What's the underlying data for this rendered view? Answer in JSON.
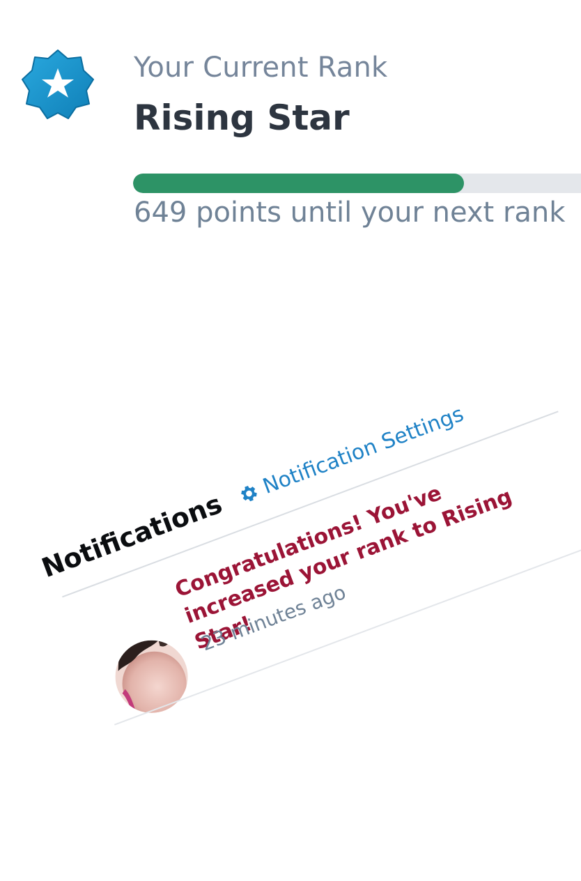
{
  "rank": {
    "subtitle": "Your Current Rank",
    "name": "Rising Star",
    "badge_icon": "star-badge-icon",
    "progress_fraction": 0.72,
    "progress_text": "649 points until your next rank"
  },
  "notifications": {
    "title": "Notifications",
    "settings_icon": "gear-icon",
    "settings_label": "Notification Settings",
    "items": [
      {
        "message": "Congratulations! You've increased your rank to Rising Star!",
        "time": "23 minutes ago"
      }
    ]
  },
  "colors": {
    "badge": "#1a8fc7",
    "progress_fill": "#2d9366",
    "progress_track": "#e4e7eb",
    "notification_message": "#9b1436",
    "settings_link": "#1f82c6",
    "muted_text": "#6f8296"
  }
}
